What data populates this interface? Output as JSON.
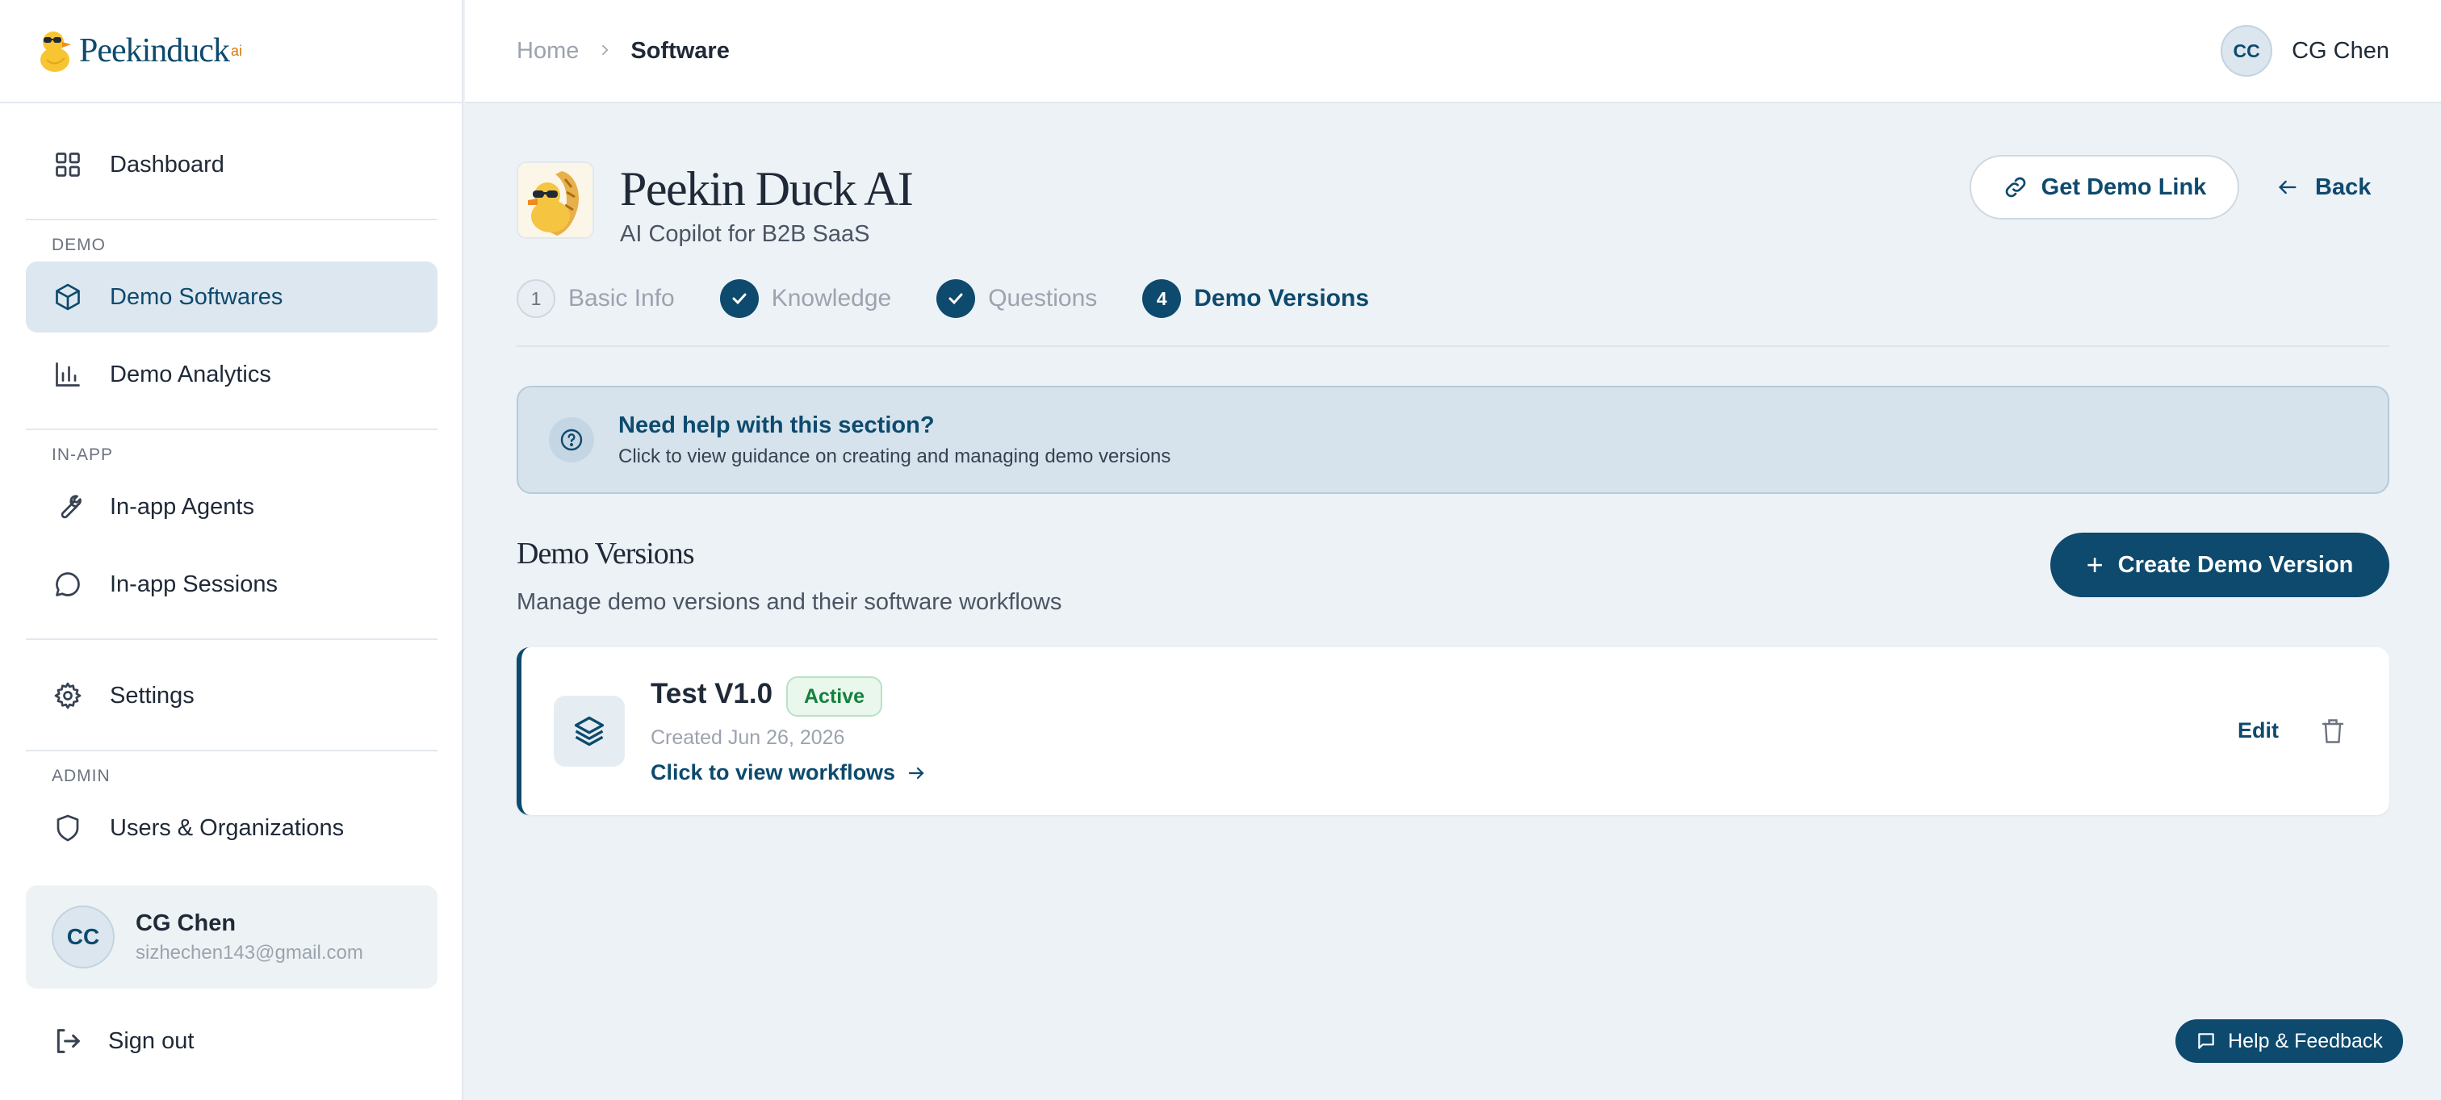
{
  "brand": {
    "name": "Peekinduck",
    "suffix": "ai"
  },
  "sidebar": {
    "dashboard": "Dashboard",
    "sections": {
      "demo": "DEMO",
      "in_app": "IN-APP",
      "admin": "ADMIN"
    },
    "items": {
      "demo_softwares": "Demo Softwares",
      "demo_analytics": "Demo Analytics",
      "in_app_agents": "In-app Agents",
      "in_app_sessions": "In-app Sessions",
      "settings": "Settings",
      "users_orgs": "Users & Organizations"
    },
    "user": {
      "initials": "CC",
      "name": "CG Chen",
      "email": "sizhechen143@gmail.com"
    },
    "sign_out": "Sign out"
  },
  "topbar": {
    "breadcrumb": {
      "home": "Home",
      "current": "Software"
    },
    "user": {
      "initials": "CC",
      "name": "CG Chen"
    }
  },
  "software": {
    "title": "Peekin Duck AI",
    "subtitle": "AI Copilot for B2B SaaS",
    "get_demo_link": "Get Demo Link",
    "back": "Back"
  },
  "steps": [
    {
      "marker": "1",
      "label": "Basic Info",
      "state": "pending"
    },
    {
      "marker": "check",
      "label": "Knowledge",
      "state": "done"
    },
    {
      "marker": "check",
      "label": "Questions",
      "state": "done"
    },
    {
      "marker": "4",
      "label": "Demo Versions",
      "state": "current"
    }
  ],
  "help": {
    "title": "Need help with this section?",
    "text": "Click to view guidance on creating and managing demo versions"
  },
  "demo_versions": {
    "title": "Demo Versions",
    "subtitle": "Manage demo versions and their software workflows",
    "create_button": "Create Demo Version",
    "items": [
      {
        "name": "Test V1.0",
        "status": "Active",
        "created": "Created Jun 26, 2026",
        "link": "Click to view workflows",
        "edit": "Edit"
      }
    ]
  },
  "help_feedback": "Help & Feedback",
  "colors": {
    "primary": "#0d4a6e",
    "background": "#edf2f6",
    "active_badge": "#15803d"
  }
}
